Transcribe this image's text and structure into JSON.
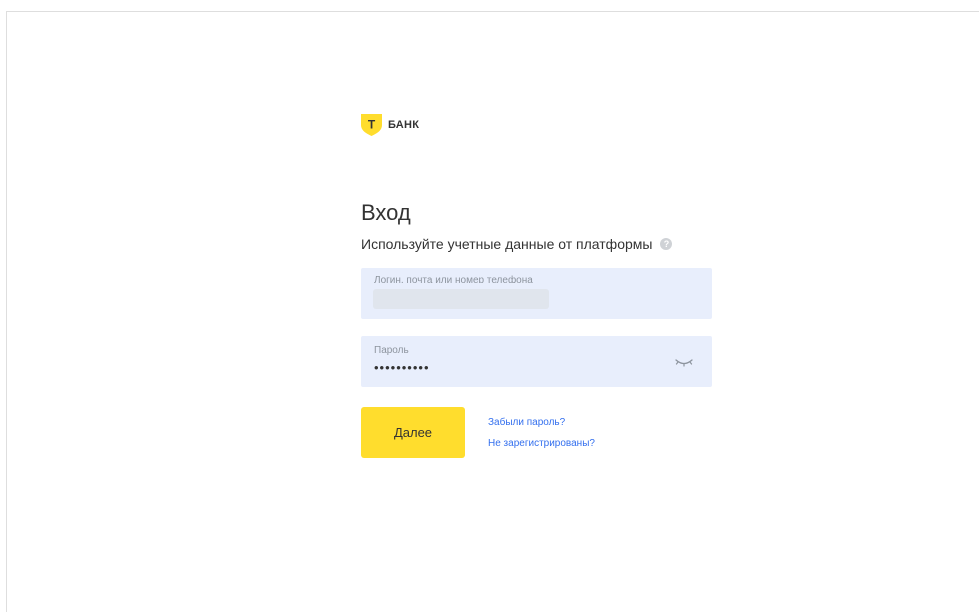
{
  "brand": {
    "logo_text": "БАНК",
    "shield_letter": "Т",
    "colors": {
      "accent": "#ffdd2d",
      "link": "#336fee",
      "field_bg": "#e8eefc"
    }
  },
  "login_form": {
    "title": "Вход",
    "subtitle": "Используйте учетные данные от платформы",
    "help_icon": "question-circle-icon",
    "login_field": {
      "label": "Логин, почта или номер телефона",
      "value": ""
    },
    "password_field": {
      "label": "Пароль",
      "value": "••••••••••",
      "toggle_icon": "eye-closed-icon"
    },
    "submit_label": "Далее",
    "forgot_password_link": "Забыли пароль?",
    "register_link": "Не зарегистрированы?"
  }
}
